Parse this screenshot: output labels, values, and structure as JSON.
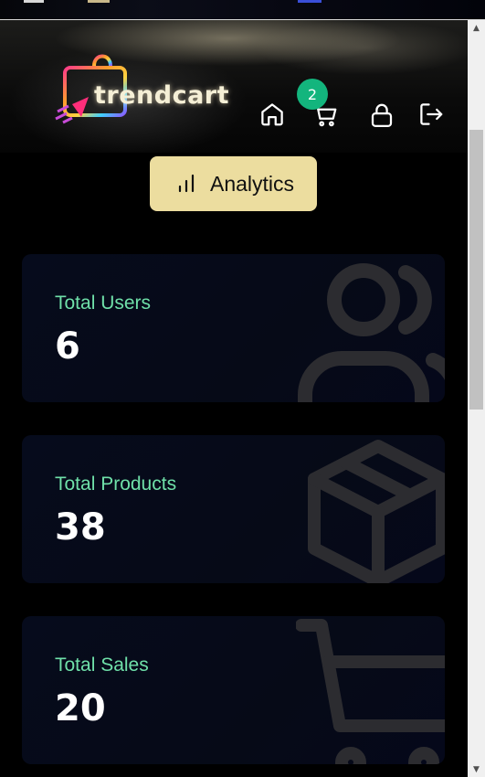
{
  "brand": {
    "name": "trendcart"
  },
  "navbar": {
    "icons": [
      "home-icon",
      "cart-icon",
      "lock-icon",
      "logout-icon"
    ],
    "cart_count": "2"
  },
  "analytics_button": {
    "label": "Analytics",
    "icon": "bar-chart-icon"
  },
  "stats": [
    {
      "label": "Total Users",
      "value": "6",
      "icon": "users-icon"
    },
    {
      "label": "Total Products",
      "value": "38",
      "icon": "package-icon"
    },
    {
      "label": "Total Sales",
      "value": "20",
      "icon": "cart-icon"
    }
  ],
  "colors": {
    "accent": "#6fe0a9",
    "badge": "#13b57d",
    "button": "#ecdd9f",
    "card": "#060b1c"
  }
}
